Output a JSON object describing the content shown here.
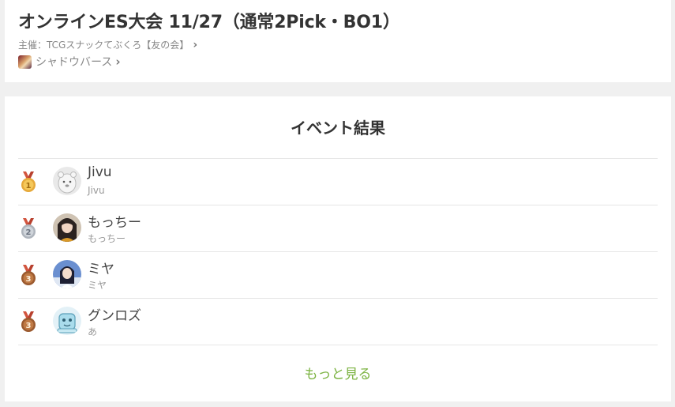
{
  "event": {
    "title": "オンラインES大会 11/27（通常2Pick・BO1）",
    "organizer": "主催：TCGスナックてぶくろ【友の会】",
    "game": "シャドウバース"
  },
  "results": {
    "heading": "イベント結果",
    "rows": [
      {
        "rank": "1",
        "name": "Jivu",
        "sub": "Jivu"
      },
      {
        "rank": "2",
        "name": "もっちー",
        "sub": "もっちー"
      },
      {
        "rank": "3",
        "name": "ミヤ",
        "sub": "ミヤ"
      },
      {
        "rank": "3",
        "name": "グンロズ",
        "sub": "あ"
      }
    ],
    "more_label": "もっと見る"
  },
  "colors": {
    "gold": "#e6a93a",
    "silver": "#aeb4bc",
    "bronze": "#9b5a2f",
    "ribbon": "#d2553f",
    "link": "#7cb342"
  }
}
